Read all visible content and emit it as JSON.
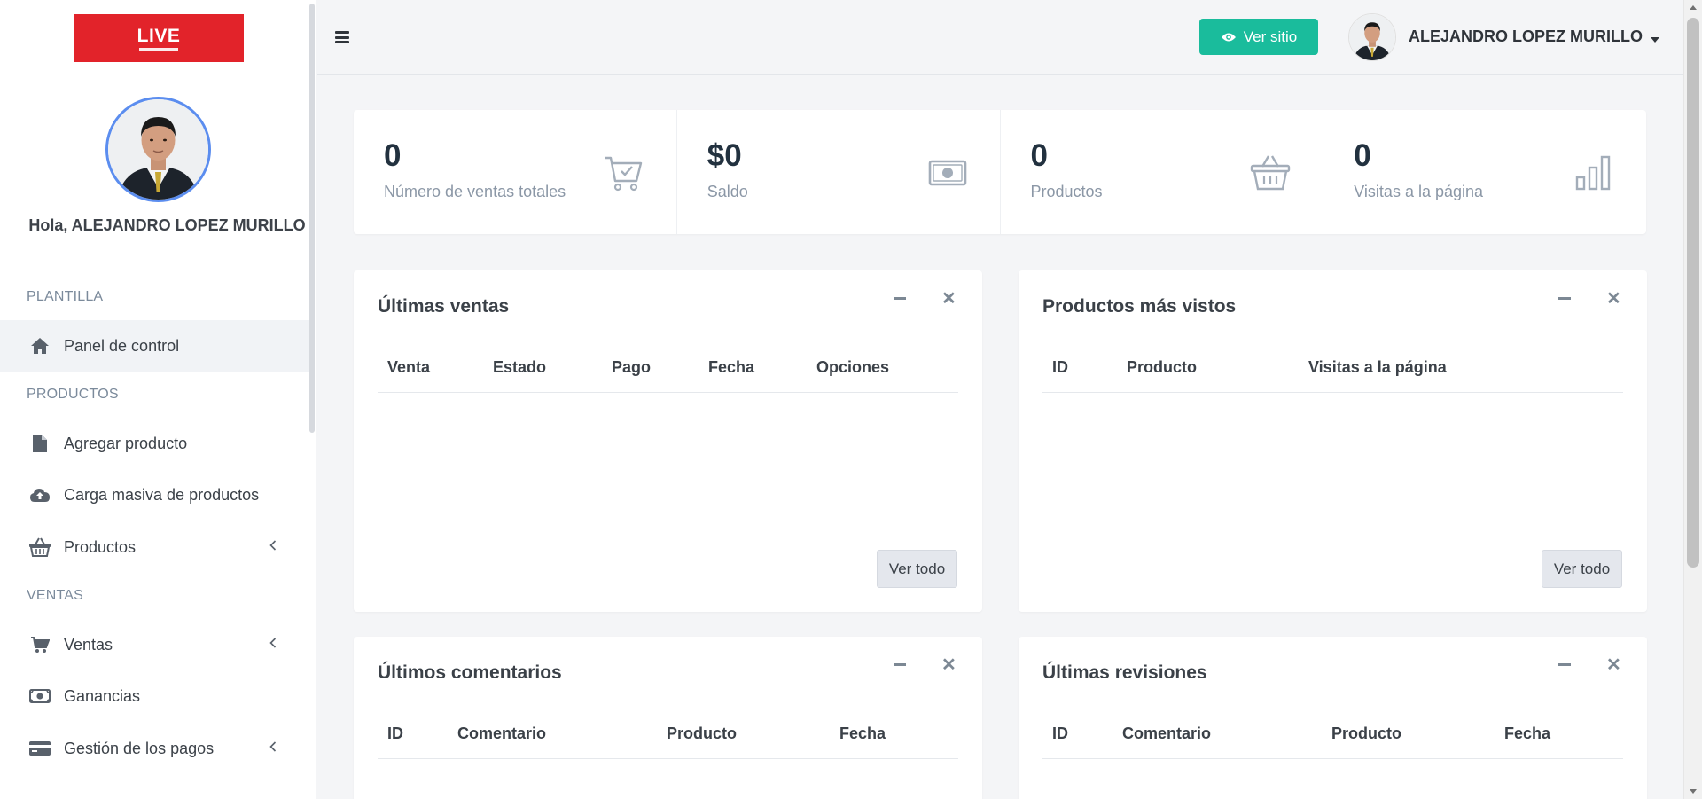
{
  "brand": {
    "logo_text": "LIVE"
  },
  "sidebar": {
    "greeting": "Hola, ALEJANDRO LOPEZ MURILLO",
    "sections": {
      "plantilla": "PLANTILLA",
      "productos": "PRODUCTOS",
      "ventas": "VENTAS"
    },
    "items": [
      {
        "label": "Panel de control",
        "icon": "home-icon",
        "active": true
      },
      {
        "label": "Agregar producto",
        "icon": "file-icon"
      },
      {
        "label": "Carga masiva de productos",
        "icon": "cloud-upload-icon"
      },
      {
        "label": "Productos",
        "icon": "basket-icon",
        "expandable": true
      },
      {
        "label": "Ventas",
        "icon": "cart-icon",
        "expandable": true
      },
      {
        "label": "Ganancias",
        "icon": "money-icon"
      },
      {
        "label": "Gestión de los pagos",
        "icon": "credit-card-icon",
        "expandable": true
      }
    ]
  },
  "header": {
    "view_site_label": "Ver sitio",
    "user_name": "ALEJANDRO LOPEZ MURILLO"
  },
  "stats": [
    {
      "value": "0",
      "label": "Número de ventas totales",
      "icon": "cart-check-icon"
    },
    {
      "value": "$0",
      "label": "Saldo",
      "icon": "money-icon"
    },
    {
      "value": "0",
      "label": "Productos",
      "icon": "basket-icon"
    },
    {
      "value": "0",
      "label": "Visitas a la página",
      "icon": "bar-chart-icon"
    }
  ],
  "cards": {
    "ventas": {
      "title": "Últimas ventas",
      "columns": [
        "Venta",
        "Estado",
        "Pago",
        "Fecha",
        "Opciones"
      ],
      "button": "Ver todo"
    },
    "vistos": {
      "title": "Productos más vistos",
      "columns": [
        "ID",
        "Producto",
        "Visitas a la página"
      ],
      "button": "Ver todo"
    },
    "comentarios": {
      "title": "Últimos comentarios",
      "columns": [
        "ID",
        "Comentario",
        "Producto",
        "Fecha"
      ]
    },
    "revisiones": {
      "title": "Últimas revisiones",
      "columns": [
        "ID",
        "Comentario",
        "Producto",
        "Fecha"
      ]
    }
  },
  "colors": {
    "accent": "#1abc9c",
    "logo": "#e2232a",
    "avatar_ring": "#5b8def"
  }
}
